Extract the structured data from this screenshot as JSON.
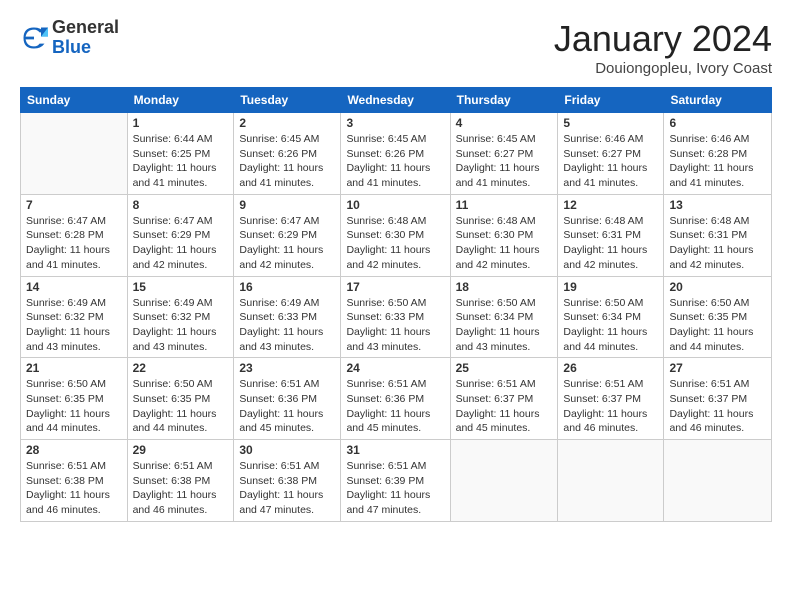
{
  "header": {
    "logo_general": "General",
    "logo_blue": "Blue",
    "month_title": "January 2024",
    "subtitle": "Douiongopleu, Ivory Coast"
  },
  "days_of_week": [
    "Sunday",
    "Monday",
    "Tuesday",
    "Wednesday",
    "Thursday",
    "Friday",
    "Saturday"
  ],
  "weeks": [
    [
      {
        "day": "",
        "info": ""
      },
      {
        "day": "1",
        "info": "Sunrise: 6:44 AM\nSunset: 6:25 PM\nDaylight: 11 hours\nand 41 minutes."
      },
      {
        "day": "2",
        "info": "Sunrise: 6:45 AM\nSunset: 6:26 PM\nDaylight: 11 hours\nand 41 minutes."
      },
      {
        "day": "3",
        "info": "Sunrise: 6:45 AM\nSunset: 6:26 PM\nDaylight: 11 hours\nand 41 minutes."
      },
      {
        "day": "4",
        "info": "Sunrise: 6:45 AM\nSunset: 6:27 PM\nDaylight: 11 hours\nand 41 minutes."
      },
      {
        "day": "5",
        "info": "Sunrise: 6:46 AM\nSunset: 6:27 PM\nDaylight: 11 hours\nand 41 minutes."
      },
      {
        "day": "6",
        "info": "Sunrise: 6:46 AM\nSunset: 6:28 PM\nDaylight: 11 hours\nand 41 minutes."
      }
    ],
    [
      {
        "day": "7",
        "info": "Sunrise: 6:47 AM\nSunset: 6:28 PM\nDaylight: 11 hours\nand 41 minutes."
      },
      {
        "day": "8",
        "info": "Sunrise: 6:47 AM\nSunset: 6:29 PM\nDaylight: 11 hours\nand 42 minutes."
      },
      {
        "day": "9",
        "info": "Sunrise: 6:47 AM\nSunset: 6:29 PM\nDaylight: 11 hours\nand 42 minutes."
      },
      {
        "day": "10",
        "info": "Sunrise: 6:48 AM\nSunset: 6:30 PM\nDaylight: 11 hours\nand 42 minutes."
      },
      {
        "day": "11",
        "info": "Sunrise: 6:48 AM\nSunset: 6:30 PM\nDaylight: 11 hours\nand 42 minutes."
      },
      {
        "day": "12",
        "info": "Sunrise: 6:48 AM\nSunset: 6:31 PM\nDaylight: 11 hours\nand 42 minutes."
      },
      {
        "day": "13",
        "info": "Sunrise: 6:48 AM\nSunset: 6:31 PM\nDaylight: 11 hours\nand 42 minutes."
      }
    ],
    [
      {
        "day": "14",
        "info": "Sunrise: 6:49 AM\nSunset: 6:32 PM\nDaylight: 11 hours\nand 43 minutes."
      },
      {
        "day": "15",
        "info": "Sunrise: 6:49 AM\nSunset: 6:32 PM\nDaylight: 11 hours\nand 43 minutes."
      },
      {
        "day": "16",
        "info": "Sunrise: 6:49 AM\nSunset: 6:33 PM\nDaylight: 11 hours\nand 43 minutes."
      },
      {
        "day": "17",
        "info": "Sunrise: 6:50 AM\nSunset: 6:33 PM\nDaylight: 11 hours\nand 43 minutes."
      },
      {
        "day": "18",
        "info": "Sunrise: 6:50 AM\nSunset: 6:34 PM\nDaylight: 11 hours\nand 43 minutes."
      },
      {
        "day": "19",
        "info": "Sunrise: 6:50 AM\nSunset: 6:34 PM\nDaylight: 11 hours\nand 44 minutes."
      },
      {
        "day": "20",
        "info": "Sunrise: 6:50 AM\nSunset: 6:35 PM\nDaylight: 11 hours\nand 44 minutes."
      }
    ],
    [
      {
        "day": "21",
        "info": "Sunrise: 6:50 AM\nSunset: 6:35 PM\nDaylight: 11 hours\nand 44 minutes."
      },
      {
        "day": "22",
        "info": "Sunrise: 6:50 AM\nSunset: 6:35 PM\nDaylight: 11 hours\nand 44 minutes."
      },
      {
        "day": "23",
        "info": "Sunrise: 6:51 AM\nSunset: 6:36 PM\nDaylight: 11 hours\nand 45 minutes."
      },
      {
        "day": "24",
        "info": "Sunrise: 6:51 AM\nSunset: 6:36 PM\nDaylight: 11 hours\nand 45 minutes."
      },
      {
        "day": "25",
        "info": "Sunrise: 6:51 AM\nSunset: 6:37 PM\nDaylight: 11 hours\nand 45 minutes."
      },
      {
        "day": "26",
        "info": "Sunrise: 6:51 AM\nSunset: 6:37 PM\nDaylight: 11 hours\nand 46 minutes."
      },
      {
        "day": "27",
        "info": "Sunrise: 6:51 AM\nSunset: 6:37 PM\nDaylight: 11 hours\nand 46 minutes."
      }
    ],
    [
      {
        "day": "28",
        "info": "Sunrise: 6:51 AM\nSunset: 6:38 PM\nDaylight: 11 hours\nand 46 minutes."
      },
      {
        "day": "29",
        "info": "Sunrise: 6:51 AM\nSunset: 6:38 PM\nDaylight: 11 hours\nand 46 minutes."
      },
      {
        "day": "30",
        "info": "Sunrise: 6:51 AM\nSunset: 6:38 PM\nDaylight: 11 hours\nand 47 minutes."
      },
      {
        "day": "31",
        "info": "Sunrise: 6:51 AM\nSunset: 6:39 PM\nDaylight: 11 hours\nand 47 minutes."
      },
      {
        "day": "",
        "info": ""
      },
      {
        "day": "",
        "info": ""
      },
      {
        "day": "",
        "info": ""
      }
    ]
  ]
}
